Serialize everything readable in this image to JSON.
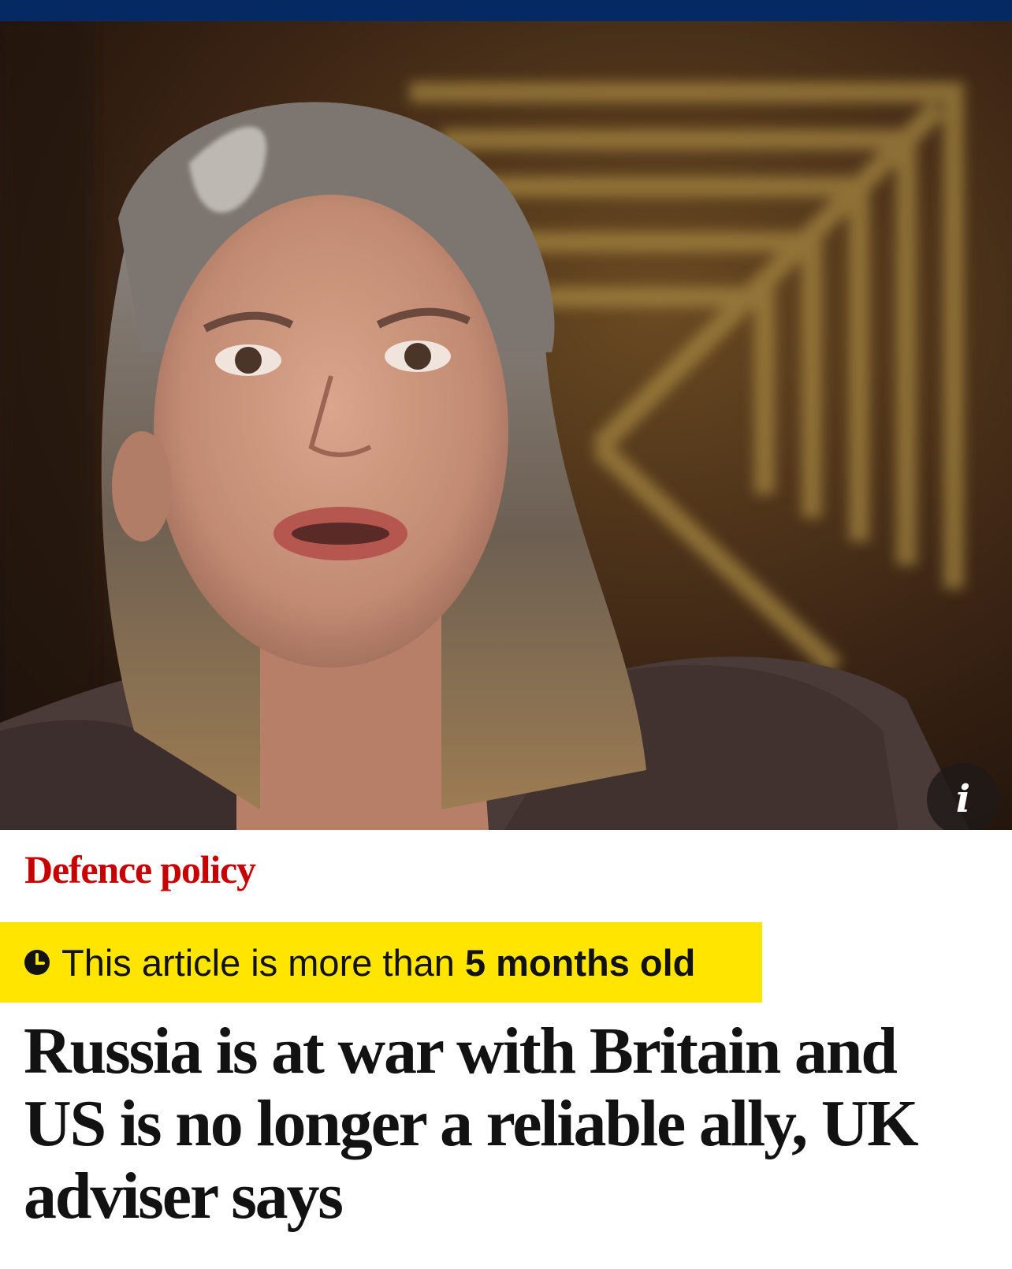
{
  "header": {
    "bar_color": "#052962"
  },
  "hero": {
    "caption_icon": "info-icon",
    "info_glyph": "i"
  },
  "article": {
    "kicker": "Defence policy",
    "kicker_color": "#c70000",
    "age_notice": {
      "icon": "clock-icon",
      "prefix": "This article is more than ",
      "age": "5 months old",
      "background": "#ffe500"
    },
    "headline_lines": [
      "Russia is at war with Britain and",
      "US is no longer a reliable ally, UK",
      "adviser says"
    ]
  }
}
